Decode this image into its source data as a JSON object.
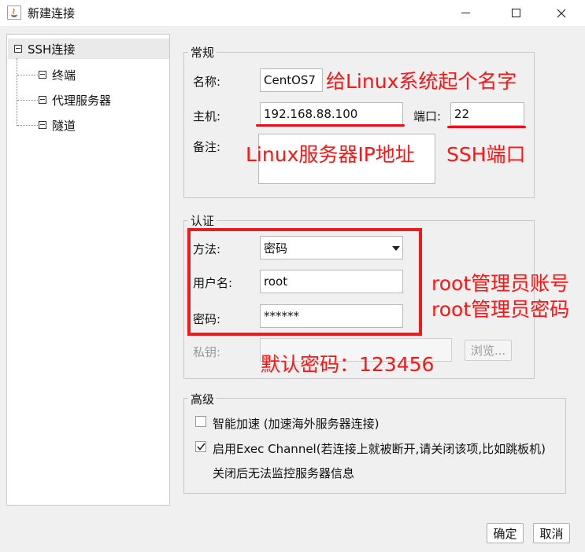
{
  "window": {
    "title": "新建连接"
  },
  "tree": {
    "root": "SSH连接",
    "children": [
      "终端",
      "代理服务器",
      "隧道"
    ]
  },
  "general": {
    "title": "常规",
    "name_label": "名称:",
    "name_value": "CentOS7",
    "host_label": "主机:",
    "host_value": "192.168.88.100",
    "port_label": "端口:",
    "port_value": "22",
    "note_label": "备注:"
  },
  "auth": {
    "title": "认证",
    "method_label": "方法:",
    "method_value": "密码",
    "user_label": "用户名:",
    "user_value": "root",
    "password_label": "密码:",
    "password_value": "******",
    "key_label": "私钥:",
    "browse_label": "浏览..."
  },
  "advanced": {
    "title": "高级",
    "accel_label": "智能加速 (加速海外服务器连接)",
    "accel_checked": false,
    "exec_label": "启用Exec Channel(若连接上就被断开,请关闭该项,比如跳板机)",
    "exec_checked": true,
    "exec_note": "关闭后无法监控服务器信息"
  },
  "buttons": {
    "ok": "确定",
    "cancel": "取消"
  },
  "annotations": {
    "name_hint": "给Linux系统起个名字",
    "host_hint": "Linux服务器IP地址",
    "port_hint": "SSH端口",
    "user_hint": "root管理员账号",
    "password_hint": "root管理员密码",
    "default_password": "默认密码：123456"
  },
  "colors": {
    "annotation": "#ff1414",
    "selection": "#eaeaea"
  }
}
